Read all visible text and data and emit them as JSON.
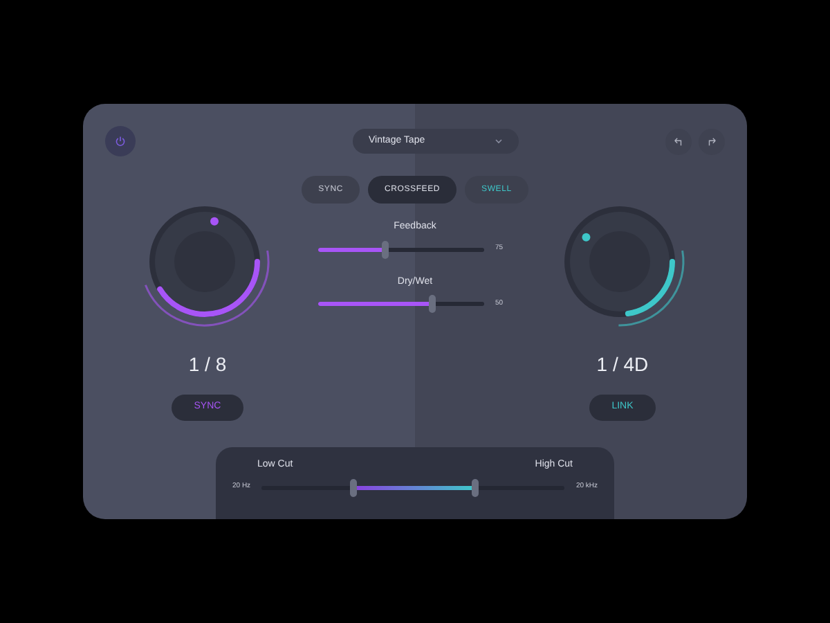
{
  "preset": {
    "value": "Vintage Tape"
  },
  "modes": [
    {
      "label": "SYNC",
      "selected": false,
      "color": "#c9cbd6"
    },
    {
      "label": "CROSSFEED",
      "selected": true,
      "color": "#dfe1ea"
    },
    {
      "label": "SWELL",
      "selected": false,
      "color": "#3ec7c9"
    }
  ],
  "knobs": [
    {
      "color": "#a855f7",
      "value": "1 / 8",
      "button": "SYNC"
    },
    {
      "color": "#3ec7c9",
      "value": "1 / 4D",
      "button": "LINK"
    }
  ],
  "sliders": [
    {
      "label": "Feedback",
      "level": 0.4,
      "reading": "75"
    },
    {
      "label": "Dry/Wet",
      "level": 0.68,
      "reading": "50"
    }
  ],
  "filter": {
    "low_label": "Low Cut",
    "high_label": "High Cut",
    "min": "20 Hz",
    "max": "20 kHz",
    "low": {
      "level": 0.3
    },
    "high": {
      "level": 0.7
    }
  }
}
